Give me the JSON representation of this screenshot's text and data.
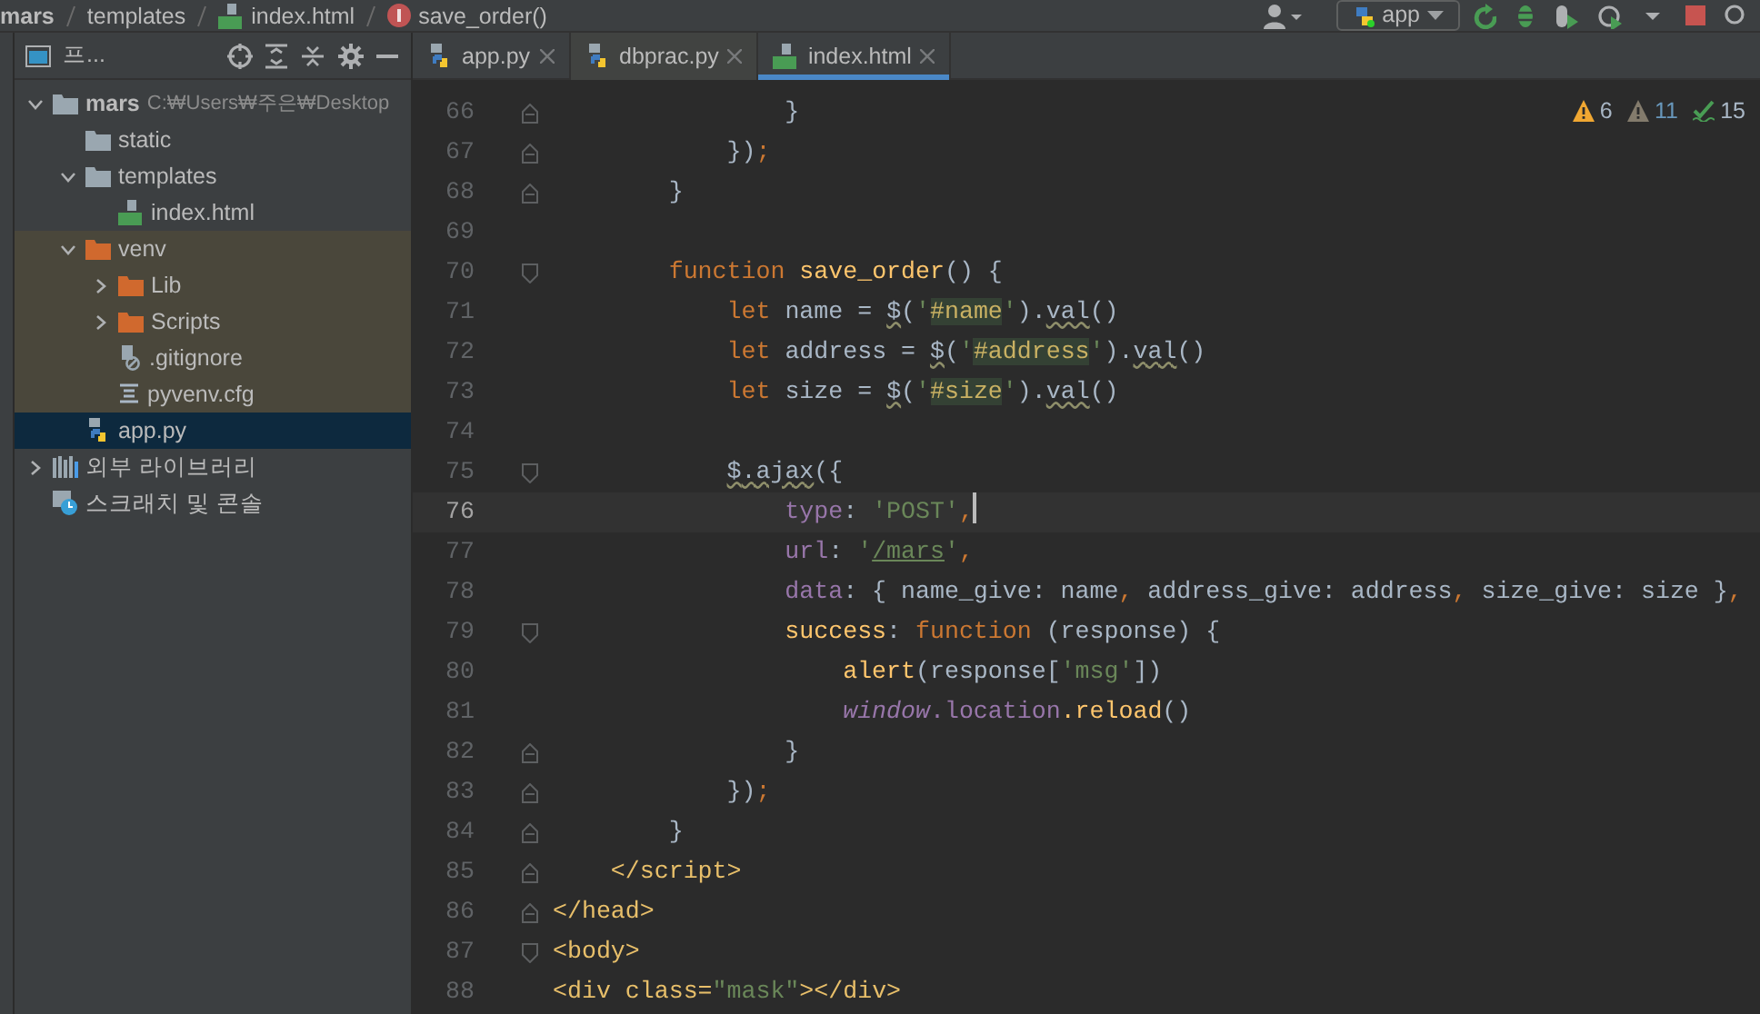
{
  "breadcrumb": [
    {
      "label": "mars",
      "kind": "project"
    },
    {
      "label": "templates",
      "kind": "folder"
    },
    {
      "label": "index.html",
      "kind": "html"
    },
    {
      "label": "save_order()",
      "kind": "function"
    }
  ],
  "toolbar": {
    "run_config": "app"
  },
  "project_panel": {
    "title": "프...",
    "tree": [
      {
        "label": "mars",
        "hint": "C:₩Users₩주은₩Desktop",
        "kind": "folder",
        "expanded": true,
        "selected": false,
        "children": [
          {
            "label": "static",
            "kind": "folder",
            "selected": false
          },
          {
            "label": "templates",
            "kind": "folder",
            "expanded": true,
            "selected": false,
            "children": [
              {
                "label": "index.html",
                "kind": "html",
                "selected": false
              }
            ]
          },
          {
            "label": "venv",
            "kind": "excluded-folder",
            "expanded": true,
            "selected": false,
            "children": [
              {
                "label": "Lib",
                "kind": "excluded-folder",
                "expanded": false,
                "selected": false
              },
              {
                "label": "Scripts",
                "kind": "excluded-folder",
                "expanded": false,
                "selected": false
              },
              {
                "label": ".gitignore",
                "kind": "ignore-file",
                "selected": false
              },
              {
                "label": "pyvenv.cfg",
                "kind": "text-file",
                "selected": false
              }
            ]
          },
          {
            "label": "app.py",
            "kind": "python",
            "selected": true
          }
        ]
      },
      {
        "label": "외부 라이브러리",
        "kind": "library",
        "expanded": false,
        "selected": false
      },
      {
        "label": "스크래치 및 콘솔",
        "kind": "scratch",
        "selected": false
      }
    ]
  },
  "tabs": [
    {
      "label": "app.py",
      "kind": "python",
      "selected": false
    },
    {
      "label": "dbprac.py",
      "kind": "python",
      "selected": false
    },
    {
      "label": "index.html",
      "kind": "html",
      "selected": true
    }
  ],
  "inspections": [
    {
      "kind": "warning",
      "count": "6"
    },
    {
      "kind": "weak-warning",
      "count": "11"
    },
    {
      "kind": "typo",
      "count": "15"
    }
  ],
  "code_lines": [
    {
      "number": "66",
      "fold_close": true,
      "current": false,
      "tokens": [
        {
          "text": "                }",
          "kind": "txt"
        }
      ]
    },
    {
      "number": "67",
      "fold_close": true,
      "current": false,
      "tokens": [
        {
          "text": "            })",
          "kind": "txt"
        },
        {
          "text": ";",
          "kind": "kw"
        }
      ]
    },
    {
      "number": "68",
      "fold_close": true,
      "current": false,
      "tokens": [
        {
          "text": "        }",
          "kind": "txt"
        }
      ]
    },
    {
      "number": "69",
      "current": false
    },
    {
      "number": "70",
      "fold_open": true,
      "current": false,
      "tokens": [
        {
          "text": "        function ",
          "kind": "kw"
        },
        {
          "text": "save_order",
          "kind": "fn"
        },
        {
          "text": "() {",
          "kind": "txt"
        }
      ]
    },
    {
      "number": "71",
      "current": false,
      "tokens": [
        {
          "text": "            let",
          "kind": "kw"
        },
        {
          "text": " name = ",
          "kind": "txt"
        },
        {
          "text": "$",
          "kind": "warn"
        },
        {
          "text": "(",
          "kind": "txt"
        },
        {
          "text": "'",
          "kind": "str"
        },
        {
          "text": "#name",
          "kind": "strhl"
        },
        {
          "text": "'",
          "kind": "str"
        },
        {
          "text": ").",
          "kind": "txt"
        },
        {
          "text": "val",
          "kind": "warn"
        },
        {
          "text": "()",
          "kind": "txt"
        }
      ]
    },
    {
      "number": "72",
      "current": false,
      "tokens": [
        {
          "text": "            let",
          "kind": "kw"
        },
        {
          "text": " address = ",
          "kind": "txt"
        },
        {
          "text": "$",
          "kind": "warn"
        },
        {
          "text": "(",
          "kind": "txt"
        },
        {
          "text": "'",
          "kind": "str"
        },
        {
          "text": "#address",
          "kind": "strhl"
        },
        {
          "text": "'",
          "kind": "str"
        },
        {
          "text": ").",
          "kind": "txt"
        },
        {
          "text": "val",
          "kind": "warn"
        },
        {
          "text": "()",
          "kind": "txt"
        }
      ]
    },
    {
      "number": "73",
      "current": false,
      "tokens": [
        {
          "text": "            let",
          "kind": "kw"
        },
        {
          "text": " size = ",
          "kind": "txt"
        },
        {
          "text": "$",
          "kind": "warn"
        },
        {
          "text": "(",
          "kind": "txt"
        },
        {
          "text": "'",
          "kind": "str"
        },
        {
          "text": "#size",
          "kind": "strhl"
        },
        {
          "text": "'",
          "kind": "str"
        },
        {
          "text": ").",
          "kind": "txt"
        },
        {
          "text": "val",
          "kind": "warn"
        },
        {
          "text": "()",
          "kind": "txt"
        }
      ]
    },
    {
      "number": "74",
      "current": false
    },
    {
      "number": "75",
      "fold_open": true,
      "current": false,
      "tokens": [
        {
          "text": "            $",
          "kind": "warn"
        },
        {
          "text": ".ajax",
          "kind": "warn"
        },
        {
          "text": "({",
          "kind": "txt"
        }
      ]
    },
    {
      "number": "76",
      "current": true,
      "tokens": [
        {
          "text": "                type",
          "kind": "prop"
        },
        {
          "text": ": ",
          "kind": "txt"
        },
        {
          "text": "'POST'",
          "kind": "str"
        },
        {
          "text": ",",
          "kind": "kw"
        }
      ]
    },
    {
      "number": "77",
      "current": false,
      "tokens": [
        {
          "text": "                url",
          "kind": "prop"
        },
        {
          "text": ": ",
          "kind": "txt"
        },
        {
          "text": "'",
          "kind": "str"
        },
        {
          "text": "/mars",
          "kind": "link"
        },
        {
          "text": "'",
          "kind": "str"
        },
        {
          "text": ",",
          "kind": "kw"
        }
      ]
    },
    {
      "number": "78",
      "current": false,
      "tokens": [
        {
          "text": "                data",
          "kind": "prop"
        },
        {
          "text": ": { name_give: name",
          "kind": "txt"
        },
        {
          "text": ",",
          "kind": "kw"
        },
        {
          "text": " address_give: address",
          "kind": "txt"
        },
        {
          "text": ",",
          "kind": "kw"
        },
        {
          "text": " size_give: size }",
          "kind": "txt"
        },
        {
          "text": ",",
          "kind": "kw"
        }
      ]
    },
    {
      "number": "79",
      "fold_open": true,
      "current": false,
      "tokens": [
        {
          "text": "                success",
          "kind": "fn"
        },
        {
          "text": ": ",
          "kind": "txt"
        },
        {
          "text": "function",
          "kind": "kw"
        },
        {
          "text": " (response) {",
          "kind": "txt"
        }
      ]
    },
    {
      "number": "80",
      "current": false,
      "tokens": [
        {
          "text": "                    alert",
          "kind": "fn"
        },
        {
          "text": "(response[",
          "kind": "txt"
        },
        {
          "text": "'msg'",
          "kind": "str"
        },
        {
          "text": "])",
          "kind": "txt"
        }
      ]
    },
    {
      "number": "81",
      "current": false,
      "tokens": [
        {
          "text": "                    window",
          "kind": "glob"
        },
        {
          "text": ".location",
          "kind": "prop"
        },
        {
          "text": ".reload",
          "kind": "fn"
        },
        {
          "text": "()",
          "kind": "txt"
        }
      ]
    },
    {
      "number": "82",
      "fold_close": true,
      "current": false,
      "tokens": [
        {
          "text": "                }",
          "kind": "txt"
        }
      ]
    },
    {
      "number": "83",
      "fold_close": true,
      "current": false,
      "tokens": [
        {
          "text": "            })",
          "kind": "txt"
        },
        {
          "text": ";",
          "kind": "kw"
        }
      ]
    },
    {
      "number": "84",
      "fold_close": true,
      "current": false,
      "tokens": [
        {
          "text": "        }",
          "kind": "txt"
        }
      ]
    },
    {
      "number": "85",
      "fold_close": true,
      "current": false,
      "tokens": [
        {
          "text": "    </script>",
          "kind": "tag"
        }
      ]
    },
    {
      "number": "86",
      "fold_close": true,
      "current": false,
      "tokens": [
        {
          "text": "</head>",
          "kind": "tag"
        }
      ]
    },
    {
      "number": "87",
      "fold_open": true,
      "current": false,
      "tokens": [
        {
          "text": "<body>",
          "kind": "tag"
        }
      ]
    },
    {
      "number": "88",
      "current": false,
      "tokens": [
        {
          "text": "<div class=",
          "kind": "tag"
        },
        {
          "text": "\"mask\"",
          "kind": "str"
        },
        {
          "text": "></div>",
          "kind": "tag"
        }
      ]
    }
  ]
}
